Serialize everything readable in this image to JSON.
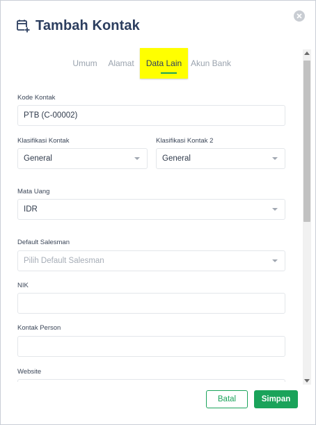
{
  "dialog": {
    "title": "Tambah Kontak",
    "icon": "add-contact-icon",
    "accent_color": "#1aa35a",
    "highlight_color": "#ffff00"
  },
  "tabs": [
    {
      "label": "Umum",
      "active": false
    },
    {
      "label": "Alamat",
      "active": false
    },
    {
      "label": "Data Lain",
      "active": true
    },
    {
      "label": "Akun Bank",
      "active": false
    }
  ],
  "form": {
    "kode_kontak": {
      "label": "Kode Kontak",
      "value": "PTB (C-00002)"
    },
    "klasifikasi_kontak": {
      "label": "Klasifikasi Kontak",
      "value": "General"
    },
    "klasifikasi_kontak_2": {
      "label": "Klasifikasi Kontak 2",
      "value": "General"
    },
    "mata_uang": {
      "label": "Mata Uang",
      "value": "IDR"
    },
    "default_salesman": {
      "label": "Default Salesman",
      "placeholder": "Pilih Default Salesman"
    },
    "nik": {
      "label": "NIK",
      "value": ""
    },
    "kontak_person": {
      "label": "Kontak Person",
      "value": ""
    },
    "website": {
      "label": "Website",
      "value": ""
    }
  },
  "actions": {
    "cancel_label": "Batal",
    "save_label": "Simpan"
  }
}
